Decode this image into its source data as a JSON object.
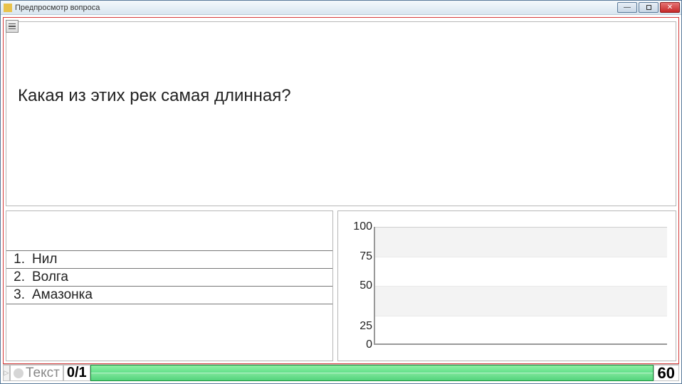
{
  "window": {
    "title": "Предпросмотр вопроса",
    "minimize_glyph": "—",
    "close_glyph": "✕"
  },
  "question": {
    "text": "Какая из этих рек самая длинная?"
  },
  "answers": [
    {
      "num": "1.",
      "text": "Нил"
    },
    {
      "num": "2.",
      "text": "Волга"
    },
    {
      "num": "3.",
      "text": "Амазонка"
    }
  ],
  "chart_data": {
    "type": "bar",
    "categories": [],
    "values": [],
    "title": "",
    "xlabel": "",
    "ylabel": "",
    "yticks": [
      0,
      25,
      50,
      75,
      100
    ],
    "ylim": [
      0,
      100
    ]
  },
  "statusbar": {
    "mode_label": "Текст",
    "count": "0/1",
    "timer": "60"
  }
}
